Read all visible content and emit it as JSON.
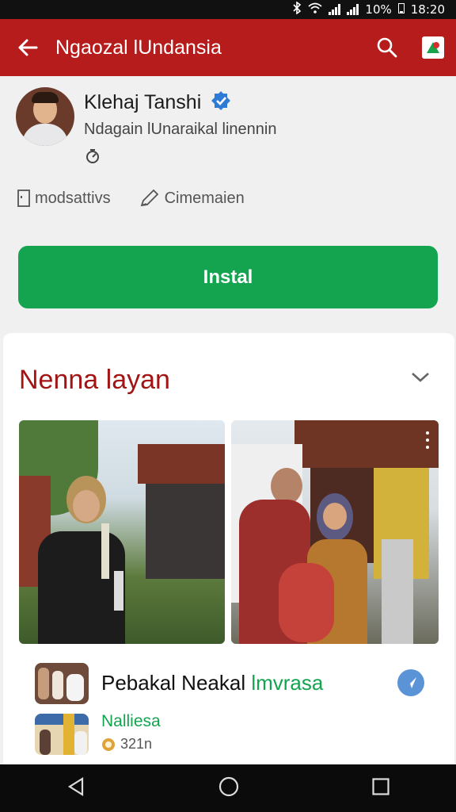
{
  "status_bar": {
    "battery": "10%",
    "time": "18:20"
  },
  "app_bar": {
    "title": "Ngaozal lUndansia"
  },
  "profile": {
    "name": "Klehaj Tanshi",
    "subtitle": "Ndagain lUnaraikal linennin",
    "meta_left": "modsattivs",
    "meta_right": "Cimemaien",
    "install_label": "Instal"
  },
  "section": {
    "title": "Nenna layan"
  },
  "related": [
    {
      "title_main": "Pebakal Neakal ",
      "title_accent": "lmvrasa"
    },
    {
      "title": "Nalliesa",
      "count": "321n"
    }
  ],
  "colors": {
    "primary": "#b71c1c",
    "install": "#14a450",
    "section_title": "#a31414"
  }
}
